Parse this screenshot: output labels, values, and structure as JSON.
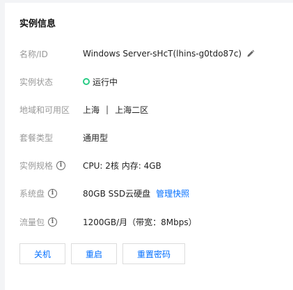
{
  "card": {
    "title": "实例信息"
  },
  "fields": [
    {
      "label": "名称/ID",
      "value": "Windows Server-sHcT(lhins-g0tdo87c)"
    },
    {
      "label": "实例状态",
      "value": "运行中",
      "status_color": "#29cc85"
    },
    {
      "label": "地域和可用区",
      "region": "上海",
      "separator": "|",
      "zone": "上海二区"
    },
    {
      "label": "套餐类型",
      "value": "通用型"
    },
    {
      "label": "实例规格",
      "value": "CPU: 2核 内存: 4GB"
    },
    {
      "label": "系统盘",
      "value": "80GB SSD云硬盘",
      "link": "管理快照"
    },
    {
      "label": "流量包",
      "value": "1200GB/月（带宽：8Mbps）"
    }
  ],
  "actions": {
    "shutdown": "关机",
    "restart": "重启",
    "reset_password": "重置密码"
  },
  "icons": {
    "edit": "pencil-icon",
    "info": "info-icon",
    "status": "status-ring-icon"
  },
  "colors": {
    "accent": "#006eff",
    "label": "#999999",
    "text": "#222222",
    "running": "#29cc85"
  }
}
